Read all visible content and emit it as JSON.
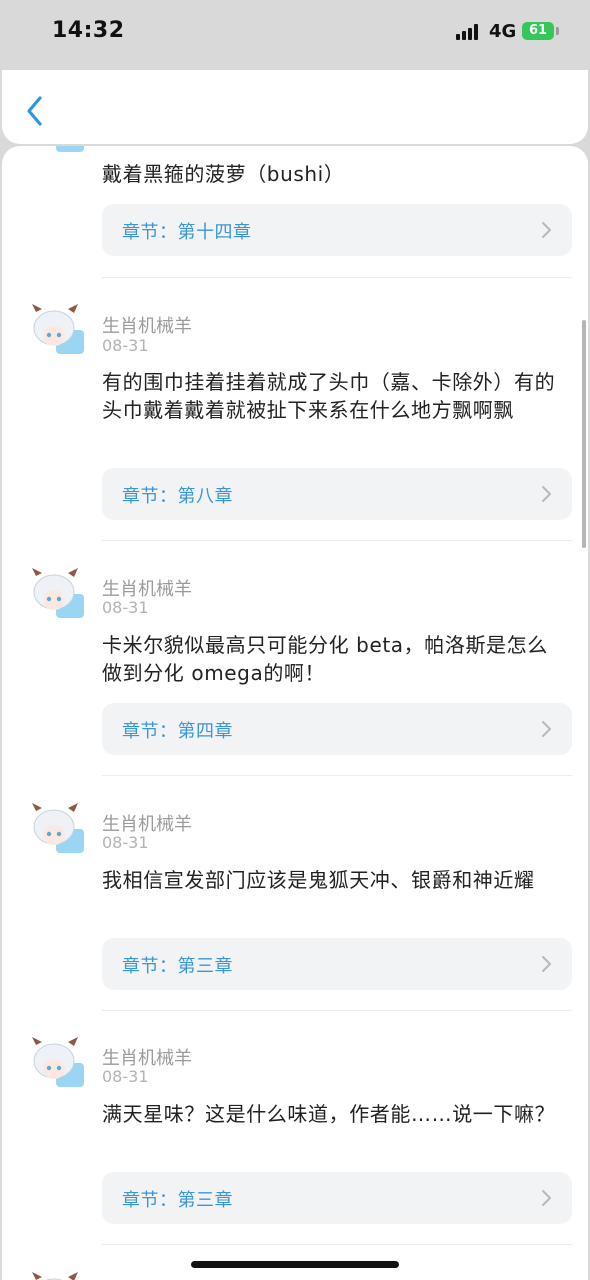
{
  "status_bar": {
    "time": "14:32",
    "network": "4G",
    "battery": "61"
  },
  "comments": [
    {
      "text": "戴着黑箍的菠萝（bushi）",
      "chapter": "章节：第十四章"
    },
    {
      "user": "生肖机械羊",
      "date": "08-31",
      "text": "有的围巾挂着挂着就成了头巾（嘉、卡除外）有的头巾戴着戴着就被扯下来系在什么地方飘啊飘",
      "chapter": "章节：第八章"
    },
    {
      "user": "生肖机械羊",
      "date": "08-31",
      "text": "卡米尔貌似最高只可能分化 beta，帕洛斯是怎么做到分化 omega的啊！",
      "chapter": "章节：第四章"
    },
    {
      "user": "生肖机械羊",
      "date": "08-31",
      "text": "我相信宣发部门应该是鬼狐天冲、银爵和神近耀",
      "chapter": "章节：第三章"
    },
    {
      "user": "生肖机械羊",
      "date": "08-31",
      "text": "满天星味？这是什么味道，作者能……说一下嘛？",
      "chapter": "章节：第三章"
    }
  ]
}
